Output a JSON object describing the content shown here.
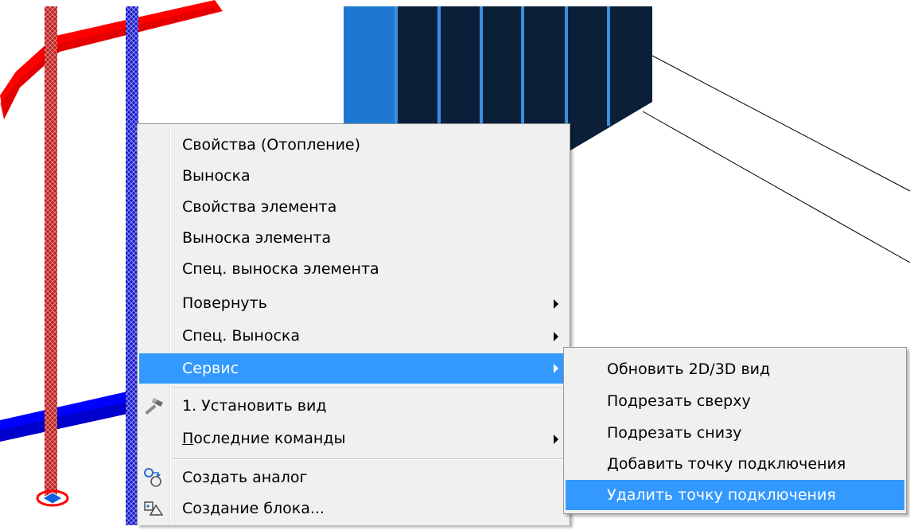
{
  "context_menu": {
    "items": [
      {
        "label": "Свойства (Отопление)"
      },
      {
        "label": "Выноска"
      },
      {
        "label": "Свойства элемента"
      },
      {
        "label": "Выноска элемента"
      },
      {
        "label": "Спец. выноска элемента"
      },
      {
        "label": "Повернуть",
        "submenu": true
      },
      {
        "label": "Спец. Выноска",
        "submenu": true
      },
      {
        "label": "Сервис",
        "submenu": true,
        "highlighted": true
      },
      {
        "label": "1. Установить вид",
        "icon": "hammer-icon"
      },
      {
        "label_accel": "П",
        "label_rest": "оследние команды",
        "submenu": true
      },
      {
        "label": "Создать аналог",
        "icon": "create-analog-icon"
      },
      {
        "label": "Создание блока...",
        "icon": "block-create-icon"
      }
    ]
  },
  "service_submenu": {
    "items": [
      {
        "label": "Обновить 2D/3D вид"
      },
      {
        "label": "Подрезать сверху"
      },
      {
        "label": "Подрезать снизу"
      },
      {
        "label": "Добавить точку подключения"
      },
      {
        "label": "Удалить точку подключения",
        "highlighted": true
      }
    ]
  },
  "colors": {
    "highlight": "#3399ff",
    "supply_pipe": "#ff0000",
    "return_pipe": "#1010ff",
    "radiator_dark": "#0b1f38",
    "radiator_light": "#1e78d2"
  }
}
